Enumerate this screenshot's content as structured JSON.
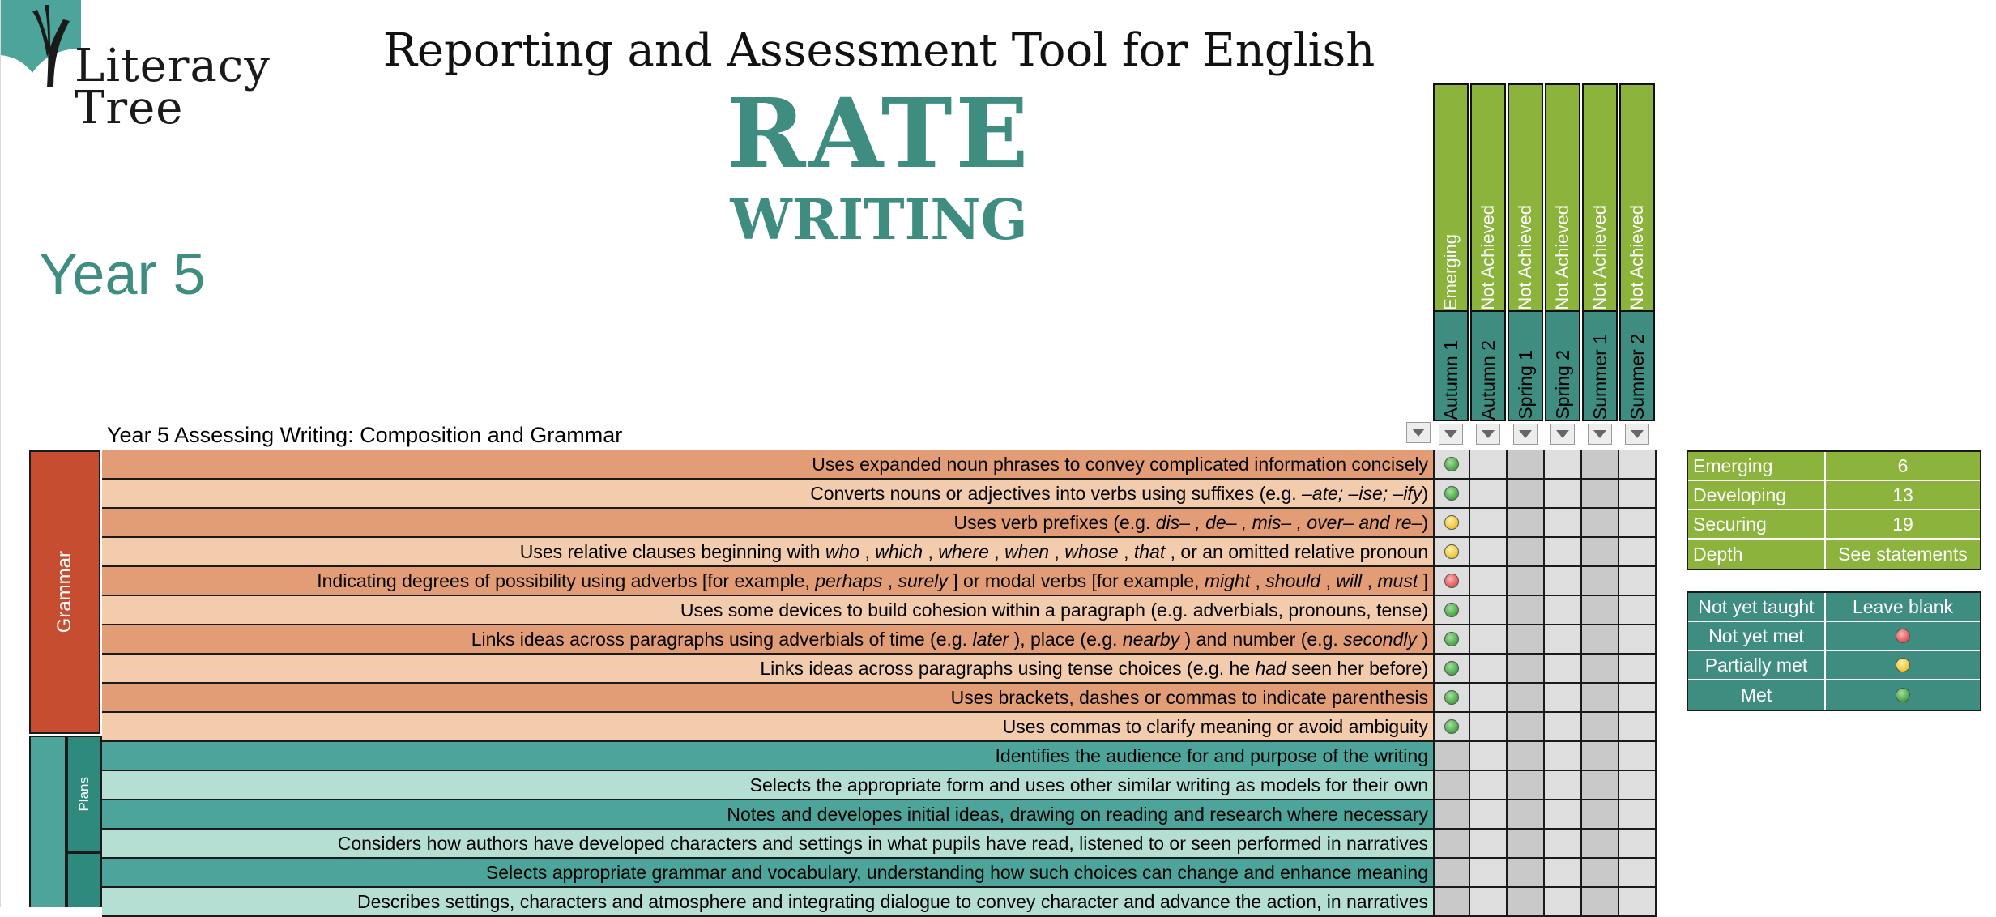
{
  "logo": {
    "line1": "Literacy",
    "line2": "Tree"
  },
  "header": {
    "title": "Reporting and Assessment Tool for English",
    "rate": "RATE",
    "subject": "WRITING",
    "year": "Year 5",
    "section": "Year 5 Assessing Writing: Composition and Grammar"
  },
  "columns": [
    {
      "status": "Emerging",
      "term": "Autumn 1"
    },
    {
      "status": "Not Achieved",
      "term": "Autumn 2"
    },
    {
      "status": "Not Achieved",
      "term": "Spring 1"
    },
    {
      "status": "Not Achieved",
      "term": "Spring 2"
    },
    {
      "status": "Not Achieved",
      "term": "Summer 1"
    },
    {
      "status": "Not Achieved",
      "term": "Summer 2"
    }
  ],
  "groups": {
    "grammar": "Grammar",
    "plans": "Plans"
  },
  "rows": [
    {
      "text": "Uses expanded noun phrases to convey complicated information concisely",
      "group": "grammar",
      "autumn1": "green"
    },
    {
      "text": "Converts nouns or adjectives into verbs using suffixes (e.g. –ate; –ise; –ify)",
      "group": "grammar",
      "autumn1": "green"
    },
    {
      "text": "Uses verb prefixes (e.g. dis– , de– , mis– , over– and re–)",
      "group": "grammar",
      "autumn1": "amber"
    },
    {
      "text": "Uses relative clauses beginning with who , which , where , when , whose , that , or an omitted relative pronoun",
      "group": "grammar",
      "autumn1": "amber"
    },
    {
      "text": "Indicating degrees of possibility using adverbs [for example, perhaps , surely ] or modal verbs [for example, might , should , will , must ]",
      "group": "grammar",
      "autumn1": "red"
    },
    {
      "text": "Uses some devices to build cohesion within a paragraph (e.g. adverbials,  pronouns, tense)",
      "group": "grammar",
      "autumn1": "green"
    },
    {
      "text": "Links ideas across paragraphs using adverbials of time (e.g. later ), place (e.g. nearby ) and number (e.g. secondly )",
      "group": "grammar",
      "autumn1": "green"
    },
    {
      "text": "Links ideas across paragraphs using tense choices (e.g. he had  seen her before)",
      "group": "grammar",
      "autumn1": "green"
    },
    {
      "text": "Uses brackets, dashes or commas to indicate parenthesis",
      "group": "grammar",
      "autumn1": "green"
    },
    {
      "text": "Uses commas to clarify meaning or avoid ambiguity",
      "group": "grammar",
      "autumn1": "green"
    },
    {
      "text": "Identifies the audience for and purpose of the writing",
      "group": "plans",
      "autumn1": ""
    },
    {
      "text": "Selects the appropriate form and uses other similar writing as models for their own",
      "group": "plans",
      "autumn1": ""
    },
    {
      "text": "Notes and developes initial ideas, drawing on reading and research where necessary",
      "group": "plans",
      "autumn1": ""
    },
    {
      "text": "Considers how authors have developed characters and settings in what pupils have read, listened to or seen performed in narratives",
      "group": "plans",
      "autumn1": ""
    },
    {
      "text": "Selects appropriate grammar and vocabulary, understanding how such choices can change and enhance meaning",
      "group": "drafts",
      "autumn1": ""
    },
    {
      "text": "Describes settings, characters and atmosphere and integrating dialogue to convey character and advance the action, in narratives",
      "group": "drafts",
      "autumn1": ""
    }
  ],
  "stages": [
    {
      "label": "Emerging",
      "value": "6"
    },
    {
      "label": "Developing",
      "value": "13"
    },
    {
      "label": "Securing",
      "value": "19"
    },
    {
      "label": "Depth",
      "value": "See statements"
    }
  ],
  "key": [
    {
      "label": "Not yet taught",
      "value": "Leave blank"
    },
    {
      "label": "Not yet met",
      "dot": "red"
    },
    {
      "label": "Partially met",
      "dot": "amber"
    },
    {
      "label": "Met",
      "dot": "green"
    }
  ],
  "colors": {
    "teal": "#3f8d80",
    "green": "#8cb43d",
    "grammar": "#c64d2f",
    "grammar_row_dark": "#e29d76",
    "grammar_row_light": "#f3ccad",
    "plans_row_dark": "#4ca49a",
    "plans_row_light": "#b6dfd3"
  }
}
